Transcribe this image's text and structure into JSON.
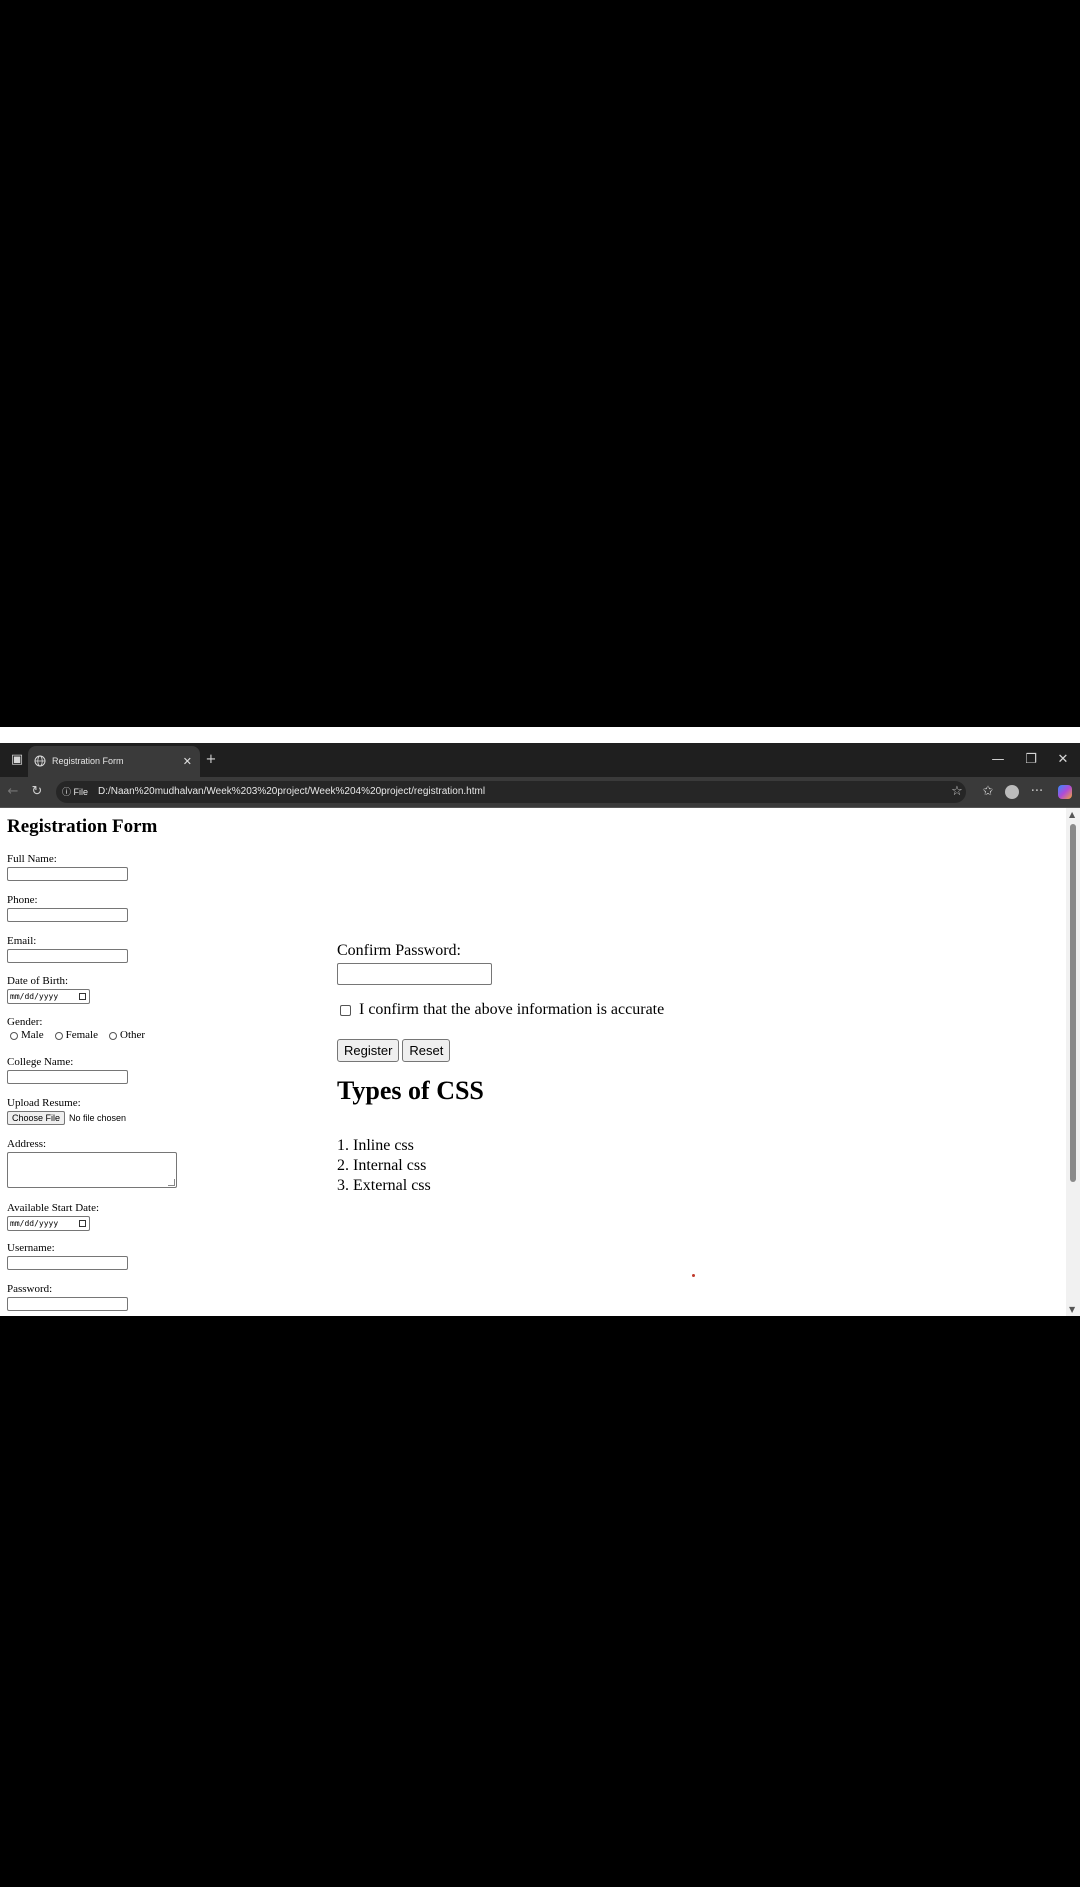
{
  "browser": {
    "tab_title": "Registration Form",
    "new_tab_symbol": "+",
    "tab_close_symbol": "✕",
    "address_prefix": "File",
    "url": "D:/Naan%20mudhalvan/Week%203%20project/Week%204%20project/registration.html",
    "window_controls": {
      "minimize": "—",
      "restore": "❐",
      "close": "✕"
    },
    "menu_symbol": "···"
  },
  "form": {
    "title": "Registration Form",
    "fields": {
      "full_name": "Full Name:",
      "phone": "Phone:",
      "email": "Email:",
      "dob": "Date of Birth:",
      "dob_placeholder": "mm/dd/yyyy",
      "gender": "Gender:",
      "gender_options": [
        "Male",
        "Female",
        "Other"
      ],
      "college": "College Name:",
      "resume": "Upload Resume:",
      "resume_button": "Choose File",
      "resume_status": "No file chosen",
      "address": "Address:",
      "start_date": "Available Start Date:",
      "start_date_placeholder": "mm/dd/yyyy",
      "username": "Username:",
      "password": "Password:",
      "confirm_password": "Confirm Password:"
    },
    "confirm_text": "I confirm that the above information is accurate",
    "register_label": "Register",
    "reset_label": "Reset"
  },
  "css_section": {
    "title": "Types of CSS",
    "items": [
      "1. Inline css",
      "2. Internal css",
      "3. External css"
    ]
  },
  "colors": {
    "chrome_dark": "#1f1f1f",
    "chrome_mid": "#3a3a3a",
    "page_bg": "#ffffff"
  }
}
